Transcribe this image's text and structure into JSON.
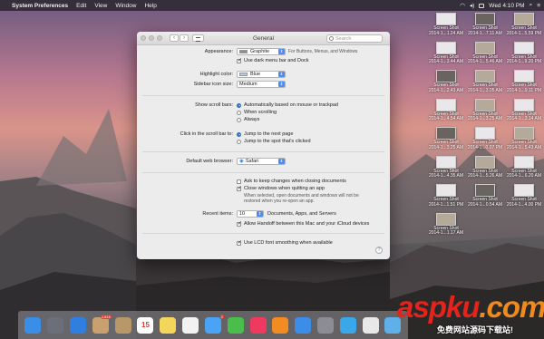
{
  "menubar": {
    "app_name": "System Preferences",
    "menus": [
      "Edit",
      "View",
      "Window",
      "Help"
    ],
    "clock": "Wed 4:10 PM"
  },
  "window": {
    "title": "General",
    "search_placeholder": "Search",
    "appearance": {
      "label": "Appearance:",
      "value": "Graphite",
      "note": "For Buttons, Menus, and Windows",
      "dark_menu_label": "Use dark menu bar and Dock",
      "dark_menu_checked": true
    },
    "highlight": {
      "label": "Highlight color:",
      "value": "Blue"
    },
    "sidebar_icon": {
      "label": "Sidebar icon size:",
      "value": "Medium"
    },
    "scroll_bars": {
      "label": "Show scroll bars:",
      "options": [
        "Automatically based on mouse or trackpad",
        "When scrolling",
        "Always"
      ],
      "selected_index": 0
    },
    "click_scroll": {
      "label": "Click in the scroll bar to:",
      "options": [
        "Jump to the next page",
        "Jump to the spot that's clicked"
      ],
      "selected_index": 0
    },
    "browser": {
      "label": "Default web browser:",
      "value": "Safari"
    },
    "ask_keep_label": "Ask to keep changes when closing documents",
    "ask_keep_checked": false,
    "close_windows_label": "Close windows when quitting an app",
    "close_windows_checked": true,
    "close_windows_note_1": "When selected, open documents and windows will not be",
    "close_windows_note_2": "restored when you re-open an app.",
    "recent": {
      "label": "Recent items:",
      "value": "10",
      "suffix": "Documents, Apps, and Servers"
    },
    "handoff_label": "Allow Handoff between this Mac and your iCloud devices",
    "handoff_checked": true,
    "lcd_label": "Use LCD font smoothing when available",
    "lcd_checked": true,
    "help": "?"
  },
  "desktop_icons": [
    {
      "l1": "Screen Shot",
      "l2": "2014-1...1.24 AM"
    },
    {
      "l1": "Screen Shot",
      "l2": "2014-1...7.11 AM"
    },
    {
      "l1": "Screen Shot",
      "l2": "2014-1...5.59 PM"
    },
    {
      "l1": "Screen Shot",
      "l2": "2014-1...3.44 AM"
    },
    {
      "l1": "Screen Shot",
      "l2": "2014-1...5.46 AM"
    },
    {
      "l1": "Screen Shot",
      "l2": "2014-1...9.20 PM"
    },
    {
      "l1": "Screen Shot",
      "l2": "2014-1...2.43 AM"
    },
    {
      "l1": "Screen Shot",
      "l2": "2014-1...3.05 AM"
    },
    {
      "l1": "Screen Shot",
      "l2": "2014-1...9.11 PM"
    },
    {
      "l1": "Screen Shot",
      "l2": "2014-1...4.54 AM"
    },
    {
      "l1": "Screen Shot",
      "l2": "2014-1...3.25 AM"
    },
    {
      "l1": "Screen Shot",
      "l2": "2014-1...3.14 AM"
    },
    {
      "l1": "Screen Shot",
      "l2": "2014-1...3.25 AM"
    },
    {
      "l1": "Screen Shot",
      "l2": "2014-1...0.07 PM"
    },
    {
      "l1": "Screen Shot",
      "l2": "2014-1...5.43 AM"
    },
    {
      "l1": "Screen Shot",
      "l2": "2014-1...4.35 AM"
    },
    {
      "l1": "Screen Shot",
      "l2": "2014-1...5.26 AM"
    },
    {
      "l1": "Screen Shot",
      "l2": "2014-1...6.20 AM"
    },
    {
      "l1": "Screen Shot",
      "l2": "2014-1...1.51 PM"
    },
    {
      "l1": "Screen Shot",
      "l2": "2014-1...0.54 AM"
    },
    {
      "l1": "Screen Shot",
      "l2": "2014-1...4.00 PM"
    },
    {
      "l1": "Screen Shot",
      "l2": "2014-1...1.17 AM"
    }
  ],
  "dock": {
    "items": [
      {
        "name": "finder-icon",
        "color": "#3b8ee8"
      },
      {
        "name": "launchpad-icon",
        "color": "#6c6f7a"
      },
      {
        "name": "safari-icon",
        "color": "#2f7ee0"
      },
      {
        "name": "stamp-icon",
        "color": "#c9a070",
        "badge": "1,816"
      },
      {
        "name": "contacts-icon",
        "color": "#b89768"
      },
      {
        "name": "calendar-icon",
        "color": "#ffffff",
        "text": "15"
      },
      {
        "name": "notes-icon",
        "color": "#f4d75a"
      },
      {
        "name": "reminders-icon",
        "color": "#f2f2f2"
      },
      {
        "name": "messages-icon",
        "color": "#4aa3f5",
        "badge": "2"
      },
      {
        "name": "facetime-icon",
        "color": "#4bbd4d"
      },
      {
        "name": "itunes-icon",
        "color": "#f0395f"
      },
      {
        "name": "ibooks-icon",
        "color": "#f28b22"
      },
      {
        "name": "app-store-icon",
        "color": "#3c8de8"
      },
      {
        "name": "system-preferences-icon",
        "color": "#8a8d93"
      },
      {
        "name": "twitter-icon",
        "color": "#3aa7e8"
      },
      {
        "name": "chrome-icon",
        "color": "#e8e8e8"
      },
      {
        "name": "chat-icon",
        "color": "#5fb0e8"
      }
    ]
  },
  "watermark": {
    "brand": "aspku",
    "tld": ".com",
    "subtitle": "免费网站源码下载站!"
  }
}
